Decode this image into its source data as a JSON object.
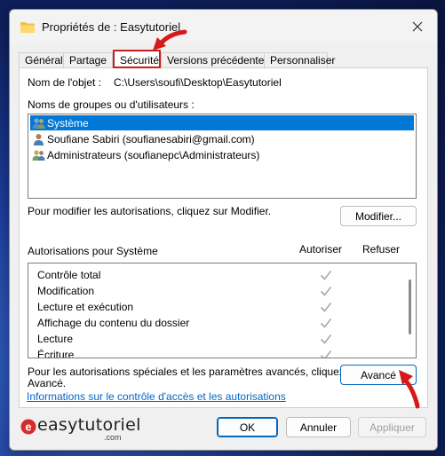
{
  "window": {
    "title": "Propriétés de : Easytutoriel",
    "close_icon": "close-icon"
  },
  "tabs": [
    {
      "label": "Général"
    },
    {
      "label": "Partage"
    },
    {
      "label": "Sécurité"
    },
    {
      "label": "Versions précédentes"
    },
    {
      "label": "Personnaliser"
    }
  ],
  "object": {
    "label": "Nom de l'objet :",
    "path": "C:\\Users\\soufi\\Desktop\\Easytutoriel"
  },
  "groups": {
    "label": "Noms de groupes ou d'utilisateurs :",
    "items": [
      {
        "name": "Système",
        "icon": "users-group-icon"
      },
      {
        "name": "Soufiane Sabiri (soufianesabiri@gmail.com)",
        "icon": "user-icon"
      },
      {
        "name": "Administrateurs (soufianepc\\Administrateurs)",
        "icon": "users-group-icon"
      }
    ]
  },
  "modify": {
    "hint": "Pour modifier les autorisations, cliquez sur Modifier.",
    "button_label": "Modifier..."
  },
  "permissions": {
    "header": "Autorisations pour Système",
    "col_allow": "Autoriser",
    "col_deny": "Refuser",
    "rows": [
      {
        "label": "Contrôle total",
        "allow": true
      },
      {
        "label": "Modification",
        "allow": true
      },
      {
        "label": "Lecture et exécution",
        "allow": true
      },
      {
        "label": "Affichage du contenu du dossier",
        "allow": true
      },
      {
        "label": "Lecture",
        "allow": true
      },
      {
        "label": "Écriture",
        "allow": true
      }
    ]
  },
  "advanced": {
    "hint_line1": "Pour les autorisations spéciales et les paramètres avancés, cliquez sur",
    "hint_line2": "Avancé.",
    "button_label": "Avancé"
  },
  "help_link": "Informations sur le contrôle d'accès et les autorisations",
  "watermark": {
    "text": "easytutoriel",
    "suffix": ".com"
  },
  "footer": {
    "ok": "OK",
    "cancel": "Annuler",
    "apply": "Appliquer"
  },
  "colors": {
    "highlight": "#c81e1e",
    "selection": "#0078d7",
    "link": "#0066cc"
  }
}
